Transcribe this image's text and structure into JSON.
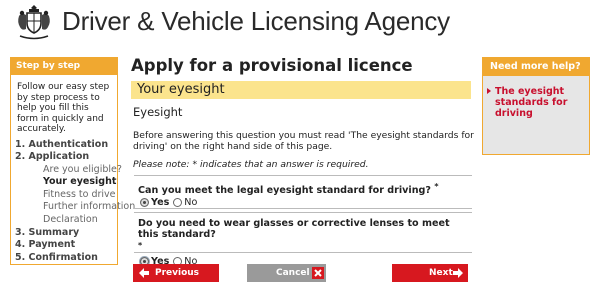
{
  "header": {
    "agency_name": "Driver & Vehicle Licensing Agency",
    "crest_icon": "royal-coat-of-arms-icon"
  },
  "left_panel": {
    "title": "Step by step",
    "intro": "Follow our easy step by step process to help you fill this form in quickly and accurately.",
    "steps": [
      {
        "label": "1. Authentication"
      },
      {
        "label": "2. Application",
        "substeps": [
          "Are you eligible?",
          "Your eyesight",
          "Fitness to drive",
          "Further information",
          "Declaration"
        ],
        "current_substep": "Your eyesight"
      },
      {
        "label": "3. Summary"
      },
      {
        "label": "4. Payment"
      },
      {
        "label": "5. Confirmation"
      }
    ]
  },
  "main": {
    "heading": "Apply for a provisional licence",
    "section_title": "Your eyesight",
    "subheading": "Eyesight",
    "intro_text": "Before answering this question you must read 'The eyesight standards for driving' on the right hand side of this page.",
    "note": "Please note: * indicates that an answer is required.",
    "questions": [
      {
        "text": "Can you meet the legal eyesight standard for driving?",
        "required_mark": "*",
        "options": [
          "Yes",
          "No"
        ],
        "selected": "Yes"
      },
      {
        "text": "Do you need to wear glasses or corrective lenses to meet this standard?",
        "required_mark": "*",
        "options": [
          "Yes",
          "No"
        ],
        "selected": "Yes"
      }
    ]
  },
  "buttons": {
    "previous": "Previous",
    "cancel": "Cancel",
    "next": "Next"
  },
  "right_panel": {
    "title": "Need more help?",
    "link": "The eyesight standards for driving"
  },
  "colors": {
    "accent_orange": "#f0a830",
    "section_yellow": "#fbe48d",
    "button_red": "#d7181f",
    "button_grey": "#9a9a9a",
    "link_red": "#c8102e"
  }
}
